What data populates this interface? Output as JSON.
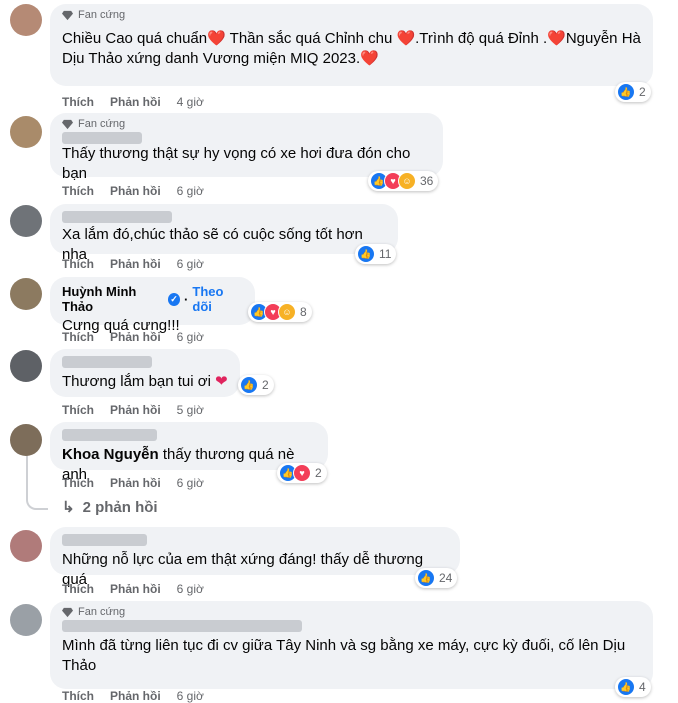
{
  "labels": {
    "like": "Thích",
    "reply": "Phản hồi",
    "fan_badge": "Fan cứng",
    "follow": "Theo dõi"
  },
  "comments": [
    {
      "text": "Chiều Cao quá chuẩn❤️ Thần sắc quá Chỉnh chu ❤️.Trình độ quá Đỉnh .❤️Nguyễn Hà Dịu Thảo xứng danh Vương miện MIQ 2023.❤️",
      "time": "4 giờ",
      "reactions": "2"
    },
    {
      "text": "Thấy thương thật sự hy vọng có xe hơi đưa đón cho bạn",
      "time": "6 giờ",
      "reactions": "36"
    },
    {
      "text": "Xa lắm đó,chúc thảo sẽ có cuộc sống tốt hơn nha",
      "time": "6 giờ",
      "reactions": "11"
    },
    {
      "author": "Huỳnh Minh Thảo",
      "text": "Cưng quá cưng!!!",
      "time": "6 giờ",
      "reactions": "8"
    },
    {
      "text": "Thương lắm bạn tui ơi",
      "time": "5 giờ",
      "reactions": "2"
    },
    {
      "mention": "Khoa Nguyễn",
      "text": " thấy thương quá nè anh",
      "time": "6 giờ",
      "reactions": "2"
    },
    {
      "text": "Những nỗ lực của em thật xứng đáng! thấy dễ thương quá",
      "time": "6 giờ",
      "reactions": "24"
    },
    {
      "text": "Mình đã từng liên tục đi cv giữa Tây Ninh và sg bằng xe máy, cực kỳ đuối, cố lên Dịu Thảo",
      "time": "6 giờ",
      "reactions": "4"
    }
  ],
  "more_replies": "2 phản hồi",
  "colors": {
    "like": "#1877f2",
    "love": "#f33e58",
    "care": "#f7b125"
  }
}
